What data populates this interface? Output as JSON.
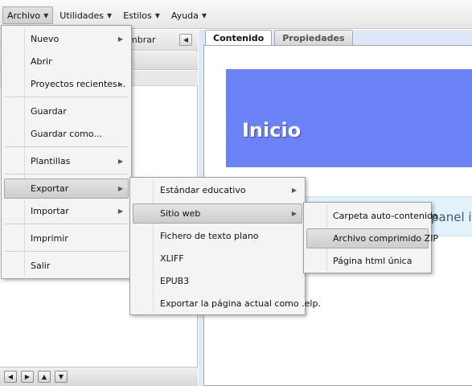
{
  "menubar": [
    {
      "label": "Archivo",
      "active": true
    },
    {
      "label": "Utilidades"
    },
    {
      "label": "Estilos"
    },
    {
      "label": "Ayuda"
    }
  ],
  "left_panel": {
    "header_text": "mbrar"
  },
  "tabs": [
    "Contenido",
    "Propiedades"
  ],
  "content": {
    "title": "Inicio",
    "hint": "panel iz"
  },
  "archivo_menu": [
    {
      "label": "Nuevo",
      "submenu": true
    },
    {
      "label": "Abrir"
    },
    {
      "label": "Proyectos recientes...",
      "submenu": true
    },
    {
      "label": "Guardar"
    },
    {
      "label": "Guardar como..."
    },
    {
      "label": "Plantillas",
      "submenu": true
    },
    {
      "label": "Exportar",
      "submenu": true,
      "highlighted": true
    },
    {
      "label": "Importar",
      "submenu": true
    },
    {
      "label": "Imprimir"
    },
    {
      "label": "Salir"
    }
  ],
  "exportar_menu": [
    {
      "label": "Estándar educativo",
      "submenu": true
    },
    {
      "label": "Sitio web",
      "submenu": true,
      "highlighted": true
    },
    {
      "label": "Fichero de texto plano"
    },
    {
      "label": "XLIFF"
    },
    {
      "label": "EPUB3"
    },
    {
      "label": "Exportar la página actual como .elp."
    }
  ],
  "sitioweb_menu": [
    {
      "label": "Carpeta auto-contenida"
    },
    {
      "label": "Archivo comprimido ZIP",
      "highlighted": true
    },
    {
      "label": "Página html única"
    }
  ],
  "colors": {
    "banner": "#6c83f8",
    "hint_box": "#e1f2fb",
    "panel_bg": "#dfe8f6"
  }
}
